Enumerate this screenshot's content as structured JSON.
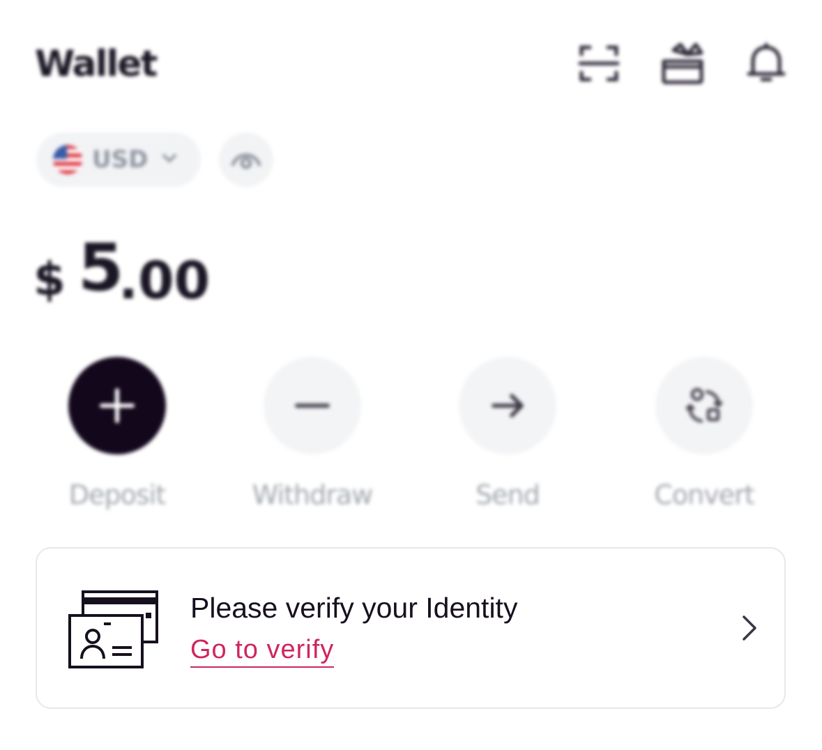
{
  "header": {
    "title": "Wallet",
    "icons": [
      "scan-icon",
      "gift-icon",
      "bell-icon"
    ]
  },
  "currency": {
    "code": "USD",
    "flag": "us-flag-icon",
    "dropdown_icon": "chevron-down-icon",
    "visibility_icon": "eye-icon"
  },
  "balance": {
    "symbol": "$",
    "integer": "5",
    "decimal": ".00"
  },
  "actions": [
    {
      "label": "Deposit",
      "icon": "plus-icon"
    },
    {
      "label": "Withdraw",
      "icon": "minus-icon"
    },
    {
      "label": "Send",
      "icon": "arrow-right-icon"
    },
    {
      "label": "Convert",
      "icon": "convert-icon"
    }
  ],
  "verify": {
    "title": "Please verify your Identity",
    "link": "Go to verify",
    "icon": "id-card-icon",
    "chevron_icon": "chevron-right-icon"
  },
  "colors": {
    "primary_dark": "#13071c",
    "accent_link": "#cf2560",
    "muted_text": "#a2a6ae",
    "pill_bg": "#f2f3f5",
    "card_border": "#e6e7ea"
  }
}
